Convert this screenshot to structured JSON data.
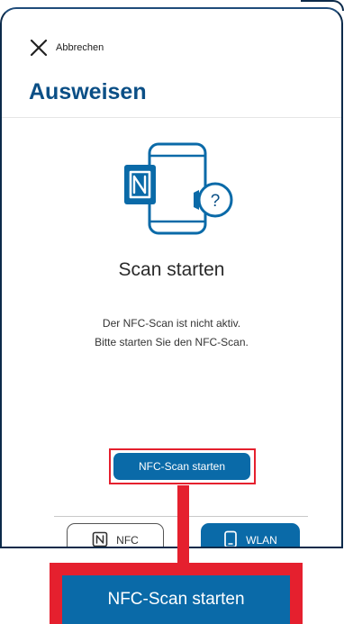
{
  "header": {
    "cancel_label": "Abbrechen",
    "cancel_icon": "close-icon",
    "title": "Ausweisen"
  },
  "illustration": {
    "icon": "nfc-phone-question-icon",
    "question_mark": "?"
  },
  "main": {
    "heading": "Scan starten",
    "description_line1": "Der NFC-Scan ist nicht aktiv.",
    "description_line2": "Bitte starten Sie den NFC-Scan.",
    "start_button_label": "NFC-Scan starten"
  },
  "mode_toggle": {
    "nfc_label": "NFC",
    "nfc_icon": "nfc-icon",
    "wlan_label": "WLAN",
    "wlan_icon": "smartphone-icon",
    "selected": "WLAN"
  },
  "callout": {
    "label": "NFC-Scan starten"
  },
  "colors": {
    "brand_blue": "#0a6aa8",
    "title_blue": "#0b4f86",
    "highlight_red": "#e5202e"
  }
}
